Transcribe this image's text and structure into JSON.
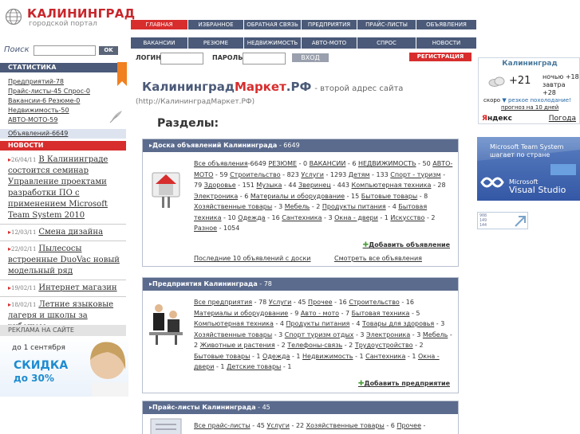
{
  "logo": {
    "title": "КАЛИНИНГРАД",
    "subtitle": "городской портал"
  },
  "nav_top": [
    "ГЛАВНАЯ",
    "ИЗБРАННОЕ",
    "ОБРАТНАЯ СВЯЗЬ",
    "ПРЕДПРИЯТИЯ",
    "ПРАЙС-ЛИСТЫ",
    "ОБЪЯВЛЕНИЯ"
  ],
  "nav_bottom": [
    "ВАКАНСИИ",
    "РЕЗЮМЕ",
    "НЕДВИЖИМОСТЬ",
    "АВТО-МОТО",
    "СПРОС",
    "НОВОСТИ"
  ],
  "login": {
    "login_label": "ЛОГИН",
    "password_label": "ПАРОЛЬ",
    "enter": "ВХОД",
    "register": "РЕГИСТРАЦИЯ"
  },
  "search": {
    "label": "Поиск",
    "ok": "OK"
  },
  "stats": {
    "heading": "СТАТИСТИКА",
    "rows": [
      "Предприятий-78",
      "Прайс-листы-45  Спрос-0",
      "Вакансии-6  Резюме-0",
      "Недвижимость-50",
      "АВТО-МОТО-59"
    ],
    "last": "Объявлений-6649"
  },
  "news": {
    "heading": "НОВОСТИ",
    "items": [
      {
        "date": "26/04/11",
        "title": "В Калининграде состоится семинар Управление проектами разработки ПО с применением Microsoft Team System 2010"
      },
      {
        "date": "12/03/11",
        "title": "Смена дизайна"
      },
      {
        "date": "22/02/11",
        "title": "Пылесосы встроенные DuoVac новый модельный ряд"
      },
      {
        "date": "19/02/11",
        "title": "Интернет магазин"
      },
      {
        "date": "18/02/11",
        "title": "Летние языковые лагеря и школы за рубежом"
      }
    ]
  },
  "ads_heading": "РЕКЛАМА НА САЙТЕ",
  "promo": {
    "until": "до 1 сентября",
    "sale": "СКИДКА",
    "percent": "до 30%"
  },
  "main": {
    "title_a": "Калининград",
    "title_b": "Маркет",
    "title_c": ".РФ",
    "title_sub": "-  второй адрес сайта",
    "subtitle": "(http://КалининградМаркет.РФ)",
    "sections": "Разделы:"
  },
  "box1": {
    "head": "Доска объявлений Калининграда",
    "count": "- 6649",
    "links": [
      [
        "Все объявления",
        "-6649 "
      ],
      [
        "РЕЗЮМЕ",
        " - 0 "
      ],
      [
        "ВАКАНСИИ",
        " - 6 "
      ],
      [
        "НЕДВИЖИМОСТЬ",
        " - 50 "
      ],
      [
        "АВТО-МОТО",
        " - 59 "
      ],
      [
        "Строительство",
        " - 823 "
      ],
      [
        "Услуги",
        " - 1293 "
      ],
      [
        "Детям",
        " - 133 "
      ],
      [
        "Спорт - туризм",
        " - 79 "
      ],
      [
        "Здоровье",
        " - 151 "
      ],
      [
        "Музыка",
        " - 44 "
      ],
      [
        "Зверинец",
        " - 443 "
      ],
      [
        "Компьютерная техника",
        " - 28 "
      ],
      [
        "Электроника",
        " - 6 "
      ],
      [
        "Материалы и оборудование",
        " - 15 "
      ],
      [
        "Бытовые товары",
        " - 8 "
      ],
      [
        "Хозяйственные товары",
        " - 3 "
      ],
      [
        "Мебель",
        " - 2 "
      ],
      [
        "Продукты питания",
        " - 4 "
      ],
      [
        "Бытовая техника",
        " - 10 "
      ],
      [
        "Одежда",
        " - 16 "
      ],
      [
        "Сантехника",
        " - 3 "
      ],
      [
        "Окна - двери",
        " - 1 "
      ],
      [
        "Искусство",
        " - 2 "
      ],
      [
        "Разное",
        " - 1054"
      ]
    ],
    "add": "Добавить объявление",
    "last10": "Последние 10 объявлений с доски",
    "all": "Смотреть все объявления"
  },
  "box2": {
    "head": "Предприятия Калининграда",
    "count": "- 78",
    "links": [
      [
        "Все предприятия",
        " - 78 "
      ],
      [
        "Услуги",
        " - 45 "
      ],
      [
        "Прочее",
        " - 16 "
      ],
      [
        "Строительство",
        " - 16 "
      ],
      [
        "Материалы и оборудование",
        " - 9 "
      ],
      [
        "Авто - мото",
        " - 7 "
      ],
      [
        "Бытовая техника",
        " - 5 "
      ],
      [
        "Компьютерная техника",
        " - 4 "
      ],
      [
        "Продукты питания",
        " - 4 "
      ],
      [
        "Товары для здоровья",
        " - 3 "
      ],
      [
        "Хозяйственные товары",
        " - 3 "
      ],
      [
        "Спорт туризм отдых",
        " - 3 "
      ],
      [
        "Электроника",
        " - 3 "
      ],
      [
        "Мебель",
        " - 2 "
      ],
      [
        "Животные и растения",
        " - 2 "
      ],
      [
        "Телефоны-связь",
        " - 2 "
      ],
      [
        "Трудоустройство",
        " - 2 "
      ],
      [
        "Бытовые товары",
        " - 1 "
      ],
      [
        "Одежда",
        " - 1 "
      ],
      [
        "Недвижимость",
        " - 1 "
      ],
      [
        "Сантехника",
        " - 1 "
      ],
      [
        "Окна - двери",
        " - 1 "
      ],
      [
        "Детские товары",
        " - 1"
      ]
    ],
    "add": "Добавить предприятие"
  },
  "box3": {
    "head": "Прайс-листы Калининграда",
    "count": "- 45",
    "links": [
      [
        "Все прайс-листы",
        " - 45 "
      ],
      [
        "Услуги",
        " - 22 "
      ],
      [
        "Хозяйственные товары",
        " - 6 "
      ],
      [
        "Прочее",
        " -"
      ]
    ]
  },
  "weather": {
    "city": "Калининград",
    "temp": "+21",
    "night": "ночью +18",
    "tomorrow": "завтра +28",
    "soon": "скоро",
    "soon_cold": "резкое похолодание!",
    "forecast": "прогноз на 10 дней",
    "yandex_y": "Я",
    "yandex_rest": "ндекс",
    "pogoda": "Погода"
  },
  "ms_banner": {
    "line1": "Microsoft Team System",
    "line2": "шагает по стране",
    "vs1": "Microsoft",
    "vs2": "Visual Studio"
  },
  "counter": {
    "line1": "908",
    "line2": "149",
    "line3": "144"
  }
}
